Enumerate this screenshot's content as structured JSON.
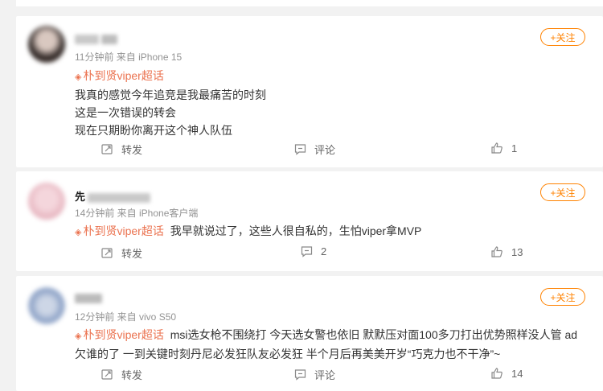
{
  "labels": {
    "follow": "+关注",
    "repost": "转发",
    "comment": "评论"
  },
  "comments": [
    {
      "user_visible": "",
      "meta": "11分钟前  来自 iPhone 15",
      "lines": [
        "我真的感觉今年追竞是我最痛苦的时刻",
        "这是一次错误的转会",
        "现在只期盼你离开这个神人队伍"
      ],
      "supertopic": "朴到贤viper超话",
      "comment_count": "",
      "like_count": "1"
    },
    {
      "user_visible": "先",
      "meta": "14分钟前  来自 iPhone客户端",
      "lines": [
        "我早就说过了，这些人很自私的，生怕viper拿MVP"
      ],
      "supertopic": "朴到贤viper超话",
      "comment_count": "2",
      "like_count": "13"
    },
    {
      "user_visible": "",
      "meta": "12分钟前  来自 vivo S50",
      "lines": [
        "msi选女枪不围绕打 今天选女警也依旧 默默压对面100多刀打出优势照样没人管 ad欠谁的了 一到关键时刻丹尼必发狂队友必发狂 半个月后再美美开岁“巧克力也不干净”~"
      ],
      "supertopic": "朴到贤viper超话",
      "comment_count": "",
      "like_count": "14"
    }
  ],
  "colors": {
    "accent": "#ff8200",
    "supertopic": "#eb7350",
    "background": "#f2f2f2"
  }
}
